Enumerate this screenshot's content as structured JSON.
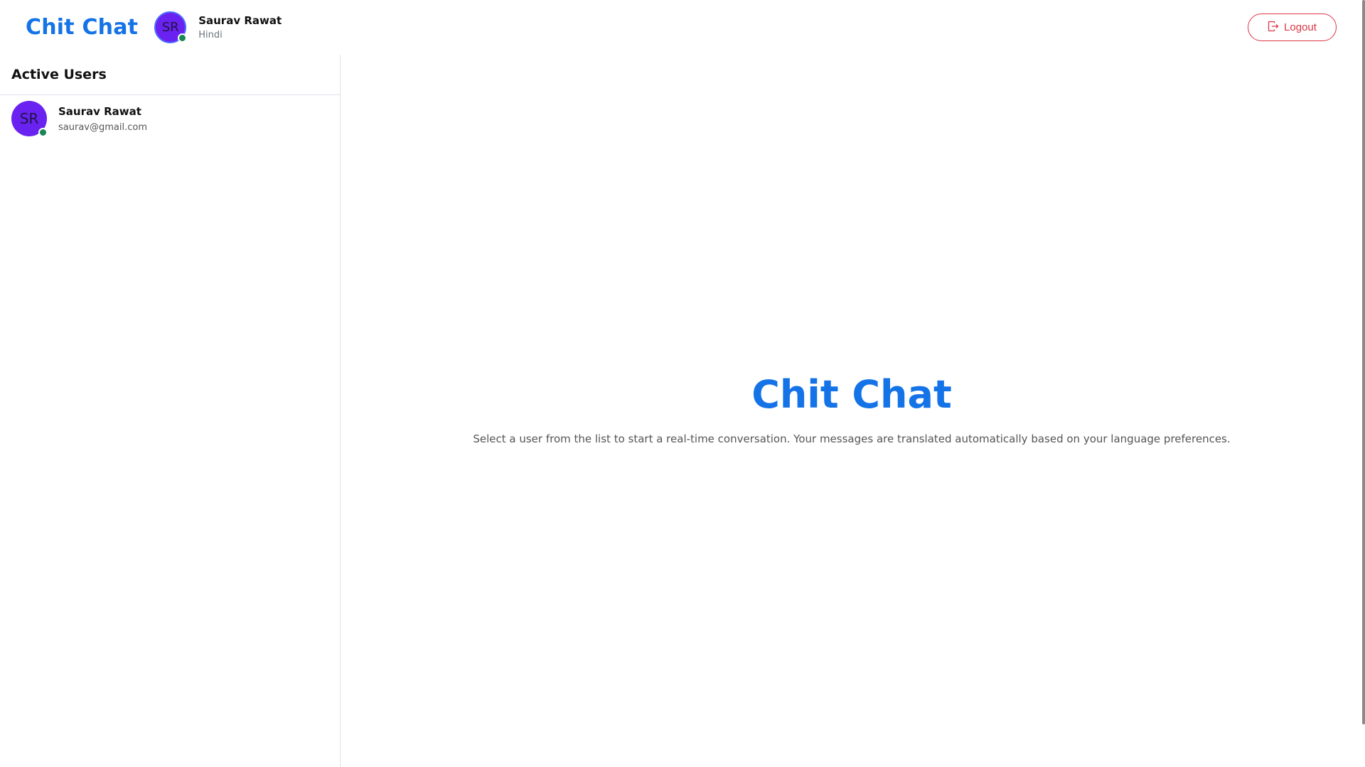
{
  "header": {
    "brand": "Chit Chat",
    "user": {
      "initials": "SR",
      "name": "Saurav Rawat",
      "language": "Hindi",
      "status": "online"
    },
    "logout_label": "Logout"
  },
  "sidebar": {
    "title": "Active Users",
    "users": [
      {
        "initials": "SR",
        "name": "Saurav Rawat",
        "email": "saurav@gmail.com",
        "status": "online"
      }
    ]
  },
  "main": {
    "title": "Chit Chat",
    "description": "Select a user from the list to start a real-time conversation. Your messages are translated automatically based on your language preferences."
  },
  "colors": {
    "brand": "#1473e6",
    "avatar": "#6a22f0",
    "online": "#198754",
    "danger": "#dc3545"
  },
  "icons": {
    "logout": "box-arrow-right-icon",
    "status": "online-status-dot"
  }
}
